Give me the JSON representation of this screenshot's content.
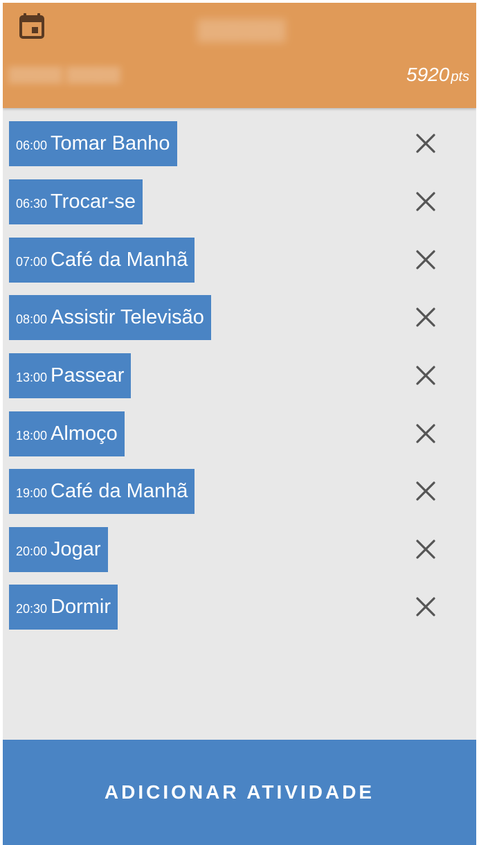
{
  "header": {
    "icon": "calendar-icon",
    "user_name": "▒▒▒▒▒▒",
    "user_subtitle": "▒▒▒▒▒ ▒▒▒▒▒",
    "points_value": "5920",
    "points_unit": "pts",
    "background_color": "#e09a58"
  },
  "activities": [
    {
      "time": "06:00",
      "name": "Tomar Banho"
    },
    {
      "time": "06:30",
      "name": "Trocar-se"
    },
    {
      "time": "07:00",
      "name": "Café da Manhã"
    },
    {
      "time": "08:00",
      "name": "Assistir Televisão"
    },
    {
      "time": "13:00",
      "name": "Passear"
    },
    {
      "time": "18:00",
      "name": "Almoço"
    },
    {
      "time": "19:00",
      "name": "Café da Manhã"
    },
    {
      "time": "20:00",
      "name": "Jogar"
    },
    {
      "time": "20:30",
      "name": "Dormir"
    }
  ],
  "remove_icon": "close-icon",
  "add_button_label": "ADICIONAR ATIVIDADE",
  "accent_color": "#4a84c4"
}
